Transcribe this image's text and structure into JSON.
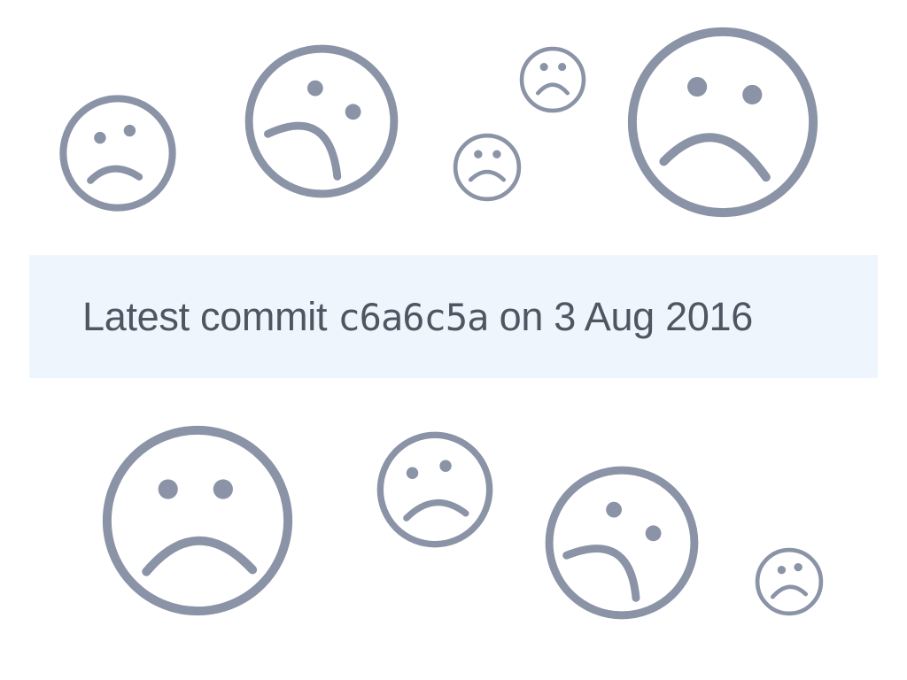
{
  "theme": {
    "icon_color": "#8b93a7",
    "bar_background": "#eef5fd",
    "text_color": "#4f5561"
  },
  "commit": {
    "prefix": "Latest commit",
    "sha": "c6a6c5a",
    "middle": "on",
    "date": "3 Aug 2016"
  },
  "icons": [
    {
      "name": "frown-icon",
      "variant": "straight"
    },
    {
      "name": "frown-icon",
      "variant": "tilted"
    },
    {
      "name": "frown-icon",
      "variant": "straight"
    },
    {
      "name": "frown-icon",
      "variant": "straight"
    },
    {
      "name": "frown-icon",
      "variant": "straight"
    },
    {
      "name": "frown-icon",
      "variant": "straight"
    },
    {
      "name": "frown-icon",
      "variant": "straight"
    },
    {
      "name": "frown-icon",
      "variant": "tilted"
    },
    {
      "name": "frown-icon",
      "variant": "straight"
    }
  ]
}
